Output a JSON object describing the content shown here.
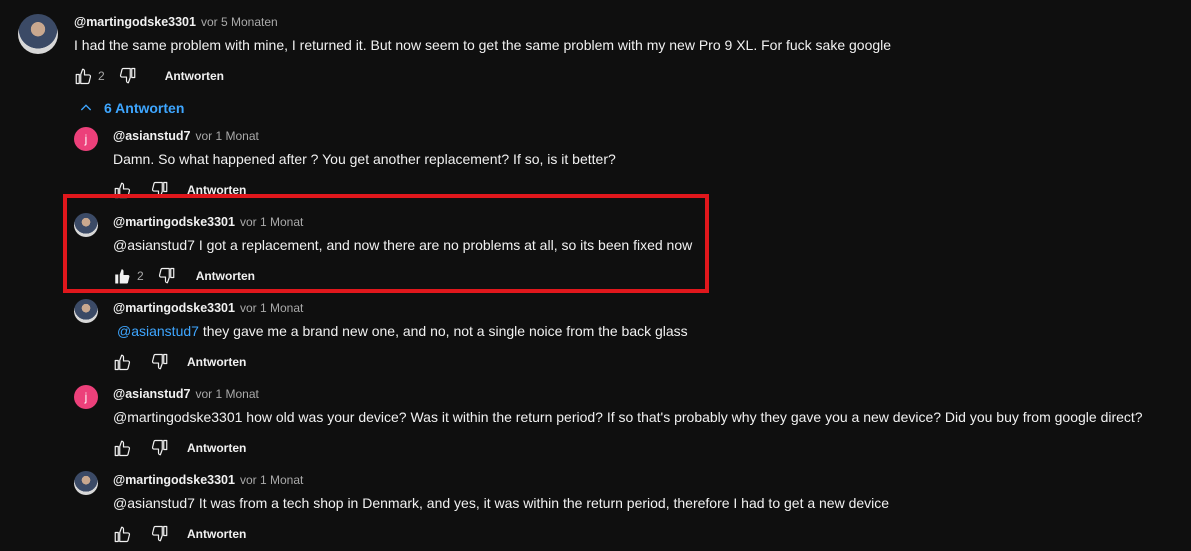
{
  "top_comment": {
    "author": "@martingodske3301",
    "time": "vor 5 Monaten",
    "text": "I had the same problem with mine, I returned it. But now seem to get the same problem with my new Pro 9 XL. For fuck sake google",
    "likes": "2",
    "reply_label": "Antworten"
  },
  "replies_toggle": {
    "label": "6 Antworten",
    "icon": "chevron-up-icon"
  },
  "replies": [
    {
      "author": "@asianstud7",
      "time": "vor 1 Monat",
      "avatar_letter": "j",
      "mention": "",
      "text": "Damn. So what happened after ? You get another replacement? If so, is it better?",
      "likes": "",
      "reply_label": "Antworten"
    },
    {
      "author": "@martingodske3301",
      "time": "vor 1 Monat",
      "mention": "",
      "text": "@asianstud7  I got a replacement, and now there are no problems at all, so its been fixed now",
      "likes": "2",
      "reply_label": "Antworten",
      "liked": true
    },
    {
      "author": "@martingodske3301",
      "time": "vor 1 Monat",
      "mention": "@asianstud7",
      "text": " they gave me a brand new one, and no, not a single noice from the back glass",
      "likes": "",
      "reply_label": "Antworten"
    },
    {
      "author": "@asianstud7",
      "time": "vor 1 Monat",
      "avatar_letter": "j",
      "mention": "",
      "text": "@martingodske3301  how old was your device? Was it within the return period? If so that's probably why they gave you a new device? Did you buy from google direct?",
      "likes": "",
      "reply_label": "Antworten"
    },
    {
      "author": "@martingodske3301",
      "time": "vor 1 Monat",
      "mention": "",
      "text": "@asianstud7  It was from a tech shop in Denmark, and yes, it was within the return period, therefore I had to get a new device",
      "likes": "",
      "reply_label": "Antworten"
    }
  ],
  "colors": {
    "background": "#0f0f0f",
    "link": "#3ea6ff",
    "highlight_border": "#e0171c",
    "letter_avatar": "#ec407a"
  }
}
